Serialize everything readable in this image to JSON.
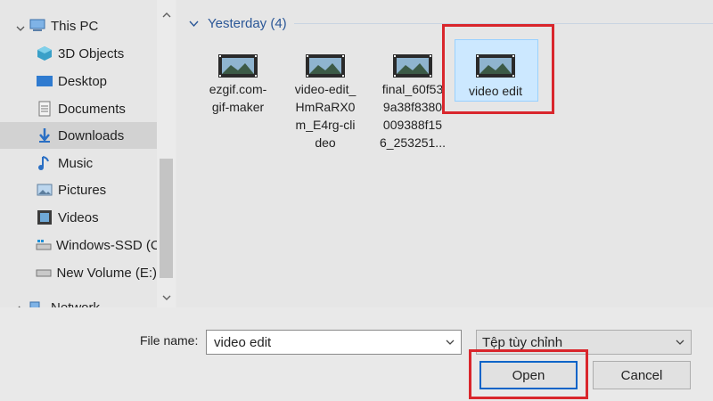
{
  "sidebar": {
    "items": [
      {
        "label": "This PC",
        "icon": "computer-icon"
      },
      {
        "label": "3D Objects",
        "icon": "cube-icon"
      },
      {
        "label": "Desktop",
        "icon": "desktop-icon"
      },
      {
        "label": "Documents",
        "icon": "document-icon"
      },
      {
        "label": "Downloads",
        "icon": "download-arrow-icon",
        "selected": true
      },
      {
        "label": "Music",
        "icon": "music-note-icon"
      },
      {
        "label": "Pictures",
        "icon": "picture-icon"
      },
      {
        "label": "Videos",
        "icon": "film-icon"
      },
      {
        "label": "Windows-SSD (C",
        "icon": "drive-icon"
      },
      {
        "label": "New Volume (E:)",
        "icon": "drive-icon"
      },
      {
        "label": "Network",
        "icon": "network-icon"
      }
    ]
  },
  "group": {
    "label": "Yesterday (4)"
  },
  "files": [
    {
      "name": "ezgif.com-gif-maker",
      "lines": [
        "ezgif.com-",
        "gif-maker"
      ]
    },
    {
      "name": "video-edit_HmRaRX0m_E4rg-clideo",
      "lines": [
        "video-edit_",
        "HmRaRX0",
        "m_E4rg-cli",
        "deo"
      ]
    },
    {
      "name": "final_60f53...",
      "lines": [
        "final_60f53",
        "9a38f8380",
        "009388f15",
        "6_253251..."
      ]
    },
    {
      "name": "video edit",
      "lines": [
        "video edit"
      ],
      "selected": true
    }
  ],
  "bottom": {
    "file_name_label": "File name:",
    "file_name_value": "video edit",
    "filter_value": "Tệp tùy chỉnh",
    "open_label": "Open",
    "cancel_label": "Cancel"
  },
  "colors": {
    "accent": "#2b5797",
    "selection": "#cce8ff",
    "highlight_box": "#d9262c",
    "primary_border": "#0a64c8"
  }
}
